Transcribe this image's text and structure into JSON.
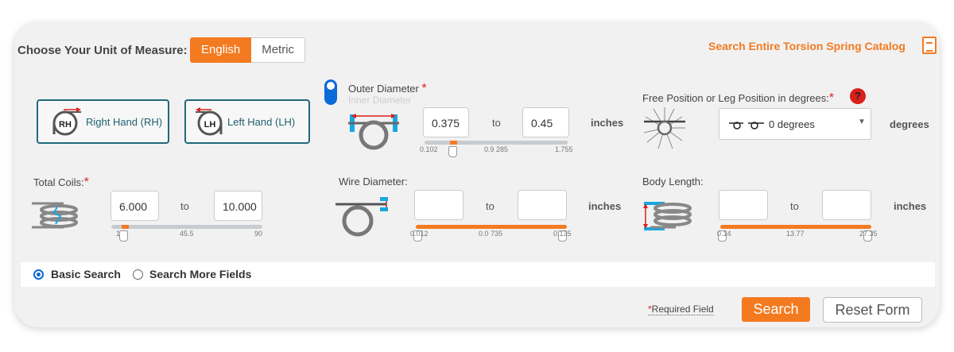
{
  "unit": {
    "label": "Choose Your Unit of Measure:",
    "options": [
      "English",
      "Metric"
    ],
    "selected": "English"
  },
  "catalog_link": "Search Entire Torsion Spring Catalog",
  "hand": {
    "right": {
      "icon_text": "RH",
      "label": "Right Hand (RH)"
    },
    "left": {
      "icon_text": "LH",
      "label": "Left Hand (LH)"
    }
  },
  "diameter": {
    "primary_label": "Outer Diameter",
    "secondary_label": "Inner Diameter",
    "min": "0.375",
    "to": "to",
    "max": "0.45",
    "units": "inches",
    "ticks": [
      "0.102",
      "0.9 285",
      "1.755"
    ]
  },
  "free_position": {
    "label": "Free Position or Leg Position in degrees:",
    "help": "?",
    "selected": "0 degrees",
    "units": "degrees"
  },
  "total_coils": {
    "label": "Total Coils:",
    "min": "6.000",
    "to": "to",
    "max": "10.000",
    "ticks": [
      "1",
      "45.5",
      "90"
    ]
  },
  "wire_diameter": {
    "label": "Wire Diameter:",
    "min": "",
    "to": "to",
    "max": "",
    "units": "inches",
    "ticks": [
      "0.012",
      "0.0 735",
      "0.135"
    ]
  },
  "body_length": {
    "label": "Body Length:",
    "min": "",
    "to": "to",
    "max": "",
    "units": "inches",
    "ticks": [
      "0.14",
      "13.77",
      "27.35"
    ]
  },
  "mode": {
    "options": [
      "Basic Search",
      "Search More Fields"
    ],
    "selected": "Basic Search"
  },
  "footer": {
    "required_star": "*",
    "required_label": "Required Field",
    "search": "Search",
    "reset": "Reset Form"
  },
  "colors": {
    "accent": "#f47a20",
    "blue": "#0a6ad8",
    "teal": "#1f6a7a",
    "required": "#e02020"
  }
}
